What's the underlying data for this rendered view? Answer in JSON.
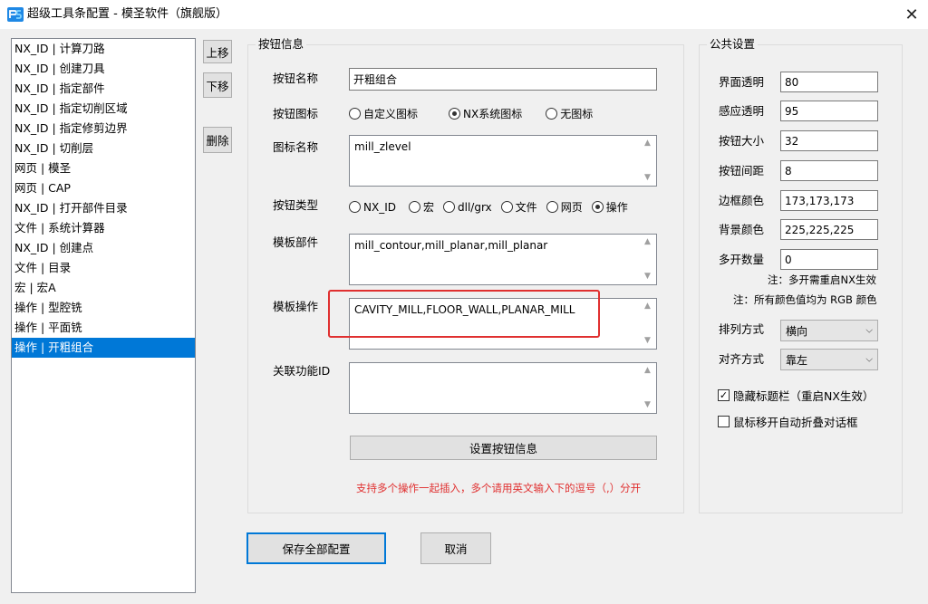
{
  "window": {
    "title": "超级工具条配置 - 模圣软件（旗舰版）",
    "close_glyph": "✕"
  },
  "list": {
    "items": [
      "NX_ID | 计算刀路",
      "NX_ID | 创建刀具",
      "NX_ID | 指定部件",
      "NX_ID | 指定切削区域",
      "NX_ID | 指定修剪边界",
      "NX_ID | 切削层",
      "网页 | 模圣",
      "网页 | CAP",
      "NX_ID | 打开部件目录",
      "文件 | 系统计算器",
      "NX_ID | 创建点",
      "文件 | 目录",
      "宏 | 宏A",
      "操作 | 型腔铣",
      "操作 | 平面铣",
      "操作 | 开粗组合"
    ],
    "selected_index": 15
  },
  "side_buttons": {
    "up": "上移",
    "down": "下移",
    "delete": "删除"
  },
  "button_info": {
    "group_title": "按钮信息",
    "name_label": "按钮名称",
    "name_value": "开粗组合",
    "icon_label": "按钮图标",
    "icon_options": [
      "自定义图标",
      "NX系统图标",
      "无图标"
    ],
    "icon_selected": 1,
    "icon_name_label": "图标名称",
    "icon_name_value": "mill_zlevel",
    "type_label": "按钮类型",
    "type_options": [
      "NX_ID",
      "宏",
      "dll/grx",
      "文件",
      "网页",
      "操作"
    ],
    "type_selected": 5,
    "template_part_label": "模板部件",
    "template_part_value": "mill_contour,mill_planar,mill_planar",
    "template_op_label": "模板操作",
    "template_op_value": "CAVITY_MILL,FLOOR_WALL,PLANAR_MILL",
    "related_id_label": "关联功能ID",
    "related_id_value": "",
    "set_button": "设置按钮信息",
    "hint": "支持多个操作一起插入，多个请用英文输入下的逗号（,）分开"
  },
  "public_settings": {
    "group_title": "公共设置",
    "fields": [
      {
        "label": "界面透明",
        "value": "80"
      },
      {
        "label": "感应透明",
        "value": "95"
      },
      {
        "label": "按钮大小",
        "value": "32"
      },
      {
        "label": "按钮间距",
        "value": "8"
      },
      {
        "label": "边框颜色",
        "value": "173,173,173"
      },
      {
        "label": "背景颜色",
        "value": "225,225,225"
      },
      {
        "label": "多开数量",
        "value": "0"
      }
    ],
    "note1": "注：多开需重启NX生效",
    "note2": "注：所有颜色值均为 RGB 颜色",
    "arrange_label": "排列方式",
    "arrange_value": "横向",
    "align_label": "对齐方式",
    "align_value": "靠左",
    "hide_titlebar_label": "隐藏标题栏（重启NX生效）",
    "hide_titlebar_checked": true,
    "auto_fold_label": "鼠标移开自动折叠对话框",
    "auto_fold_checked": false
  },
  "bottom_buttons": {
    "save_all": "保存全部配置",
    "cancel": "取消"
  },
  "colors": {
    "selection": "#0078d7",
    "highlight_red": "#e03030",
    "app_icon_blue": "#1e88e5"
  }
}
